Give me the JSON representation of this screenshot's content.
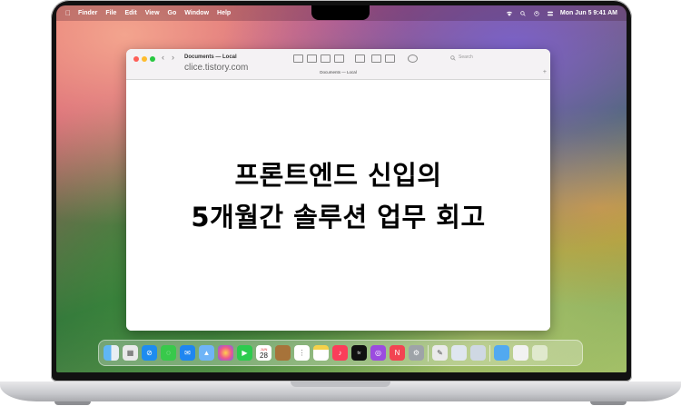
{
  "menubar": {
    "app": "Finder",
    "items": [
      "File",
      "Edit",
      "View",
      "Go",
      "Window",
      "Help"
    ],
    "clock": "Mon Jun 5  9:41 AM"
  },
  "window": {
    "title": "Documents — Local",
    "tab_title": "Documents — Local",
    "watermark": "clice.tistory.com",
    "search_placeholder": "Search",
    "back": "‹",
    "forward": "›"
  },
  "content": {
    "line1": "프론트엔드 신입의",
    "line2": "5개월간 솔루션 업무 회고"
  },
  "dock": {
    "calendar_month": "JUN",
    "calendar_day": "28",
    "tv_label": "tv"
  },
  "colors": {
    "traffic_red": "#fe5f57",
    "traffic_yellow": "#febc2e",
    "traffic_green": "#28c840"
  }
}
